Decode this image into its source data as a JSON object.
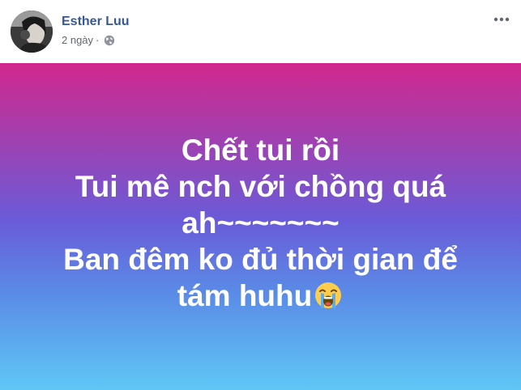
{
  "post": {
    "author": "Esther Luu",
    "time": "2 ngày",
    "separator": "·",
    "privacy_icon": "globe-icon",
    "more_icon": "more-dots-icon",
    "status_lines": [
      "Chết tui rồi",
      "Tui mê nch với chồng quá",
      "ah~~~~~~~",
      "Ban đêm ko đủ thời gian để",
      "tám huhu"
    ],
    "status_emoji": "loudly-crying-face-emoji",
    "colors": {
      "author_link": "#365899",
      "meta_text": "#616770",
      "gradient_top": "#d1288e",
      "gradient_mid": "#6a5bd8",
      "gradient_bottom": "#5fc7f5"
    }
  }
}
